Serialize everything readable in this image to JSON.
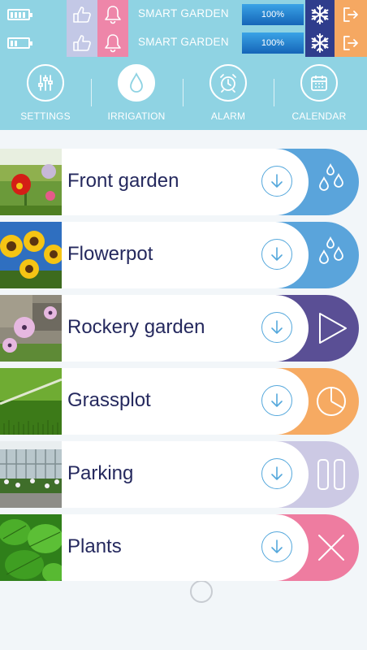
{
  "colors": {
    "bar_bg": "#8fd3e3",
    "like_tile": "#c3c8e6",
    "bell_tile": "#ee86a9",
    "snow_tile": "#2f3d8c",
    "exit_tile": "#f5a862",
    "label_text": "#25295e"
  },
  "status_rows": [
    {
      "battery_icon": "battery-full-icon",
      "battery_level": 1.0,
      "like_icon": "thumbs-up-icon",
      "bell_icon": "bell-icon",
      "name": "SMART GARDEN",
      "progress_text": "100%",
      "progress": 1.0,
      "snow_icon": "snowflake-icon",
      "exit_icon": "exit-icon"
    },
    {
      "battery_icon": "battery-low-icon",
      "battery_level": 0.3,
      "like_icon": "thumbs-up-icon",
      "bell_icon": "bell-icon",
      "name": "SMART GARDEN",
      "progress_text": "100%",
      "progress": 1.0,
      "snow_icon": "snowflake-icon",
      "exit_icon": "exit-icon"
    }
  ],
  "nav": [
    {
      "label": "SETTINGS",
      "icon": "sliders-icon",
      "active": false
    },
    {
      "label": "IRRIGATION",
      "icon": "water-drop-icon",
      "active": true
    },
    {
      "label": "ALARM",
      "icon": "alarm-clock-icon",
      "active": false
    },
    {
      "label": "CALENDAR",
      "icon": "calendar-icon",
      "active": false
    }
  ],
  "zones": [
    {
      "label": "Front garden",
      "action_icon": "water-drops-icon",
      "action_color": "#5aa4db",
      "photo": "red-tulip-garden"
    },
    {
      "label": "Flowerpot",
      "action_icon": "water-drops-icon",
      "action_color": "#5aa4db",
      "photo": "sunflowers"
    },
    {
      "label": "Rockery garden",
      "action_icon": "play-icon",
      "action_color": "#5a4f95",
      "photo": "daisies-on-rocks"
    },
    {
      "label": "Grassplot",
      "action_icon": "pie-chart-icon",
      "action_color": "#f6aa62",
      "photo": "lawn"
    },
    {
      "label": "Parking",
      "action_icon": "pause-icon",
      "action_color": "#ccc9e4",
      "photo": "greenhouse-shrubs"
    },
    {
      "label": "Plants",
      "action_icon": "close-icon",
      "action_color": "#ee7ca0",
      "photo": "green-leaves"
    }
  ],
  "download_icon": "download-icon",
  "home_icon": "home-indicator-icon"
}
